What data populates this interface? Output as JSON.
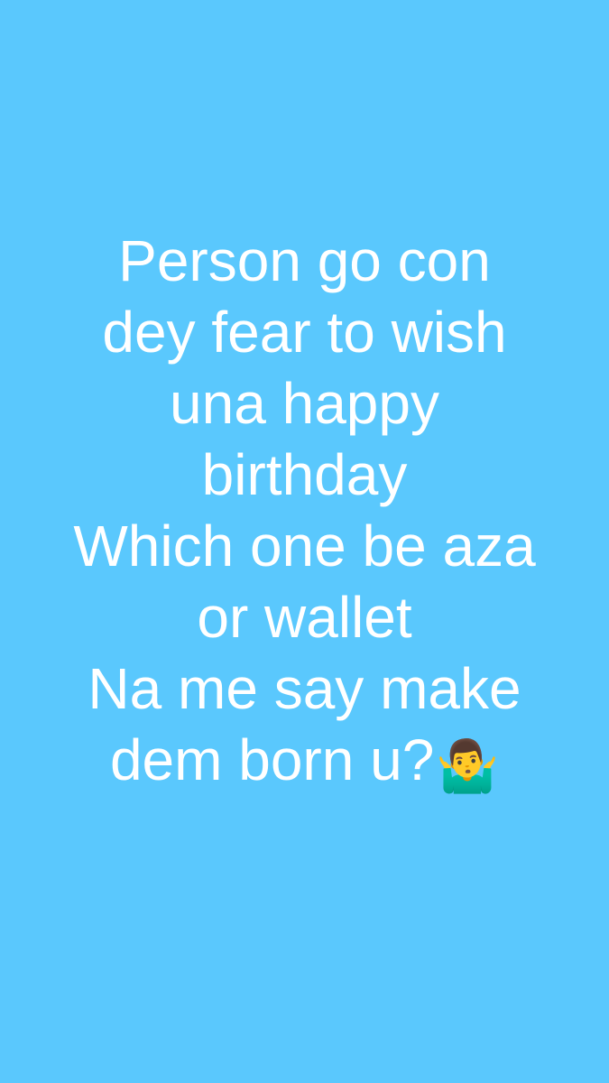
{
  "status": {
    "background_color": "#5ac8fd",
    "text_color": "#ffffff",
    "lines": [
      "Person go con",
      "dey fear to wish",
      "una happy",
      "birthday",
      "Which one be aza",
      "or wallet",
      "Na me say make",
      "dem born u?"
    ],
    "emoji": "🤷‍♂️",
    "emoji_name": "man-shrugging-icon"
  }
}
